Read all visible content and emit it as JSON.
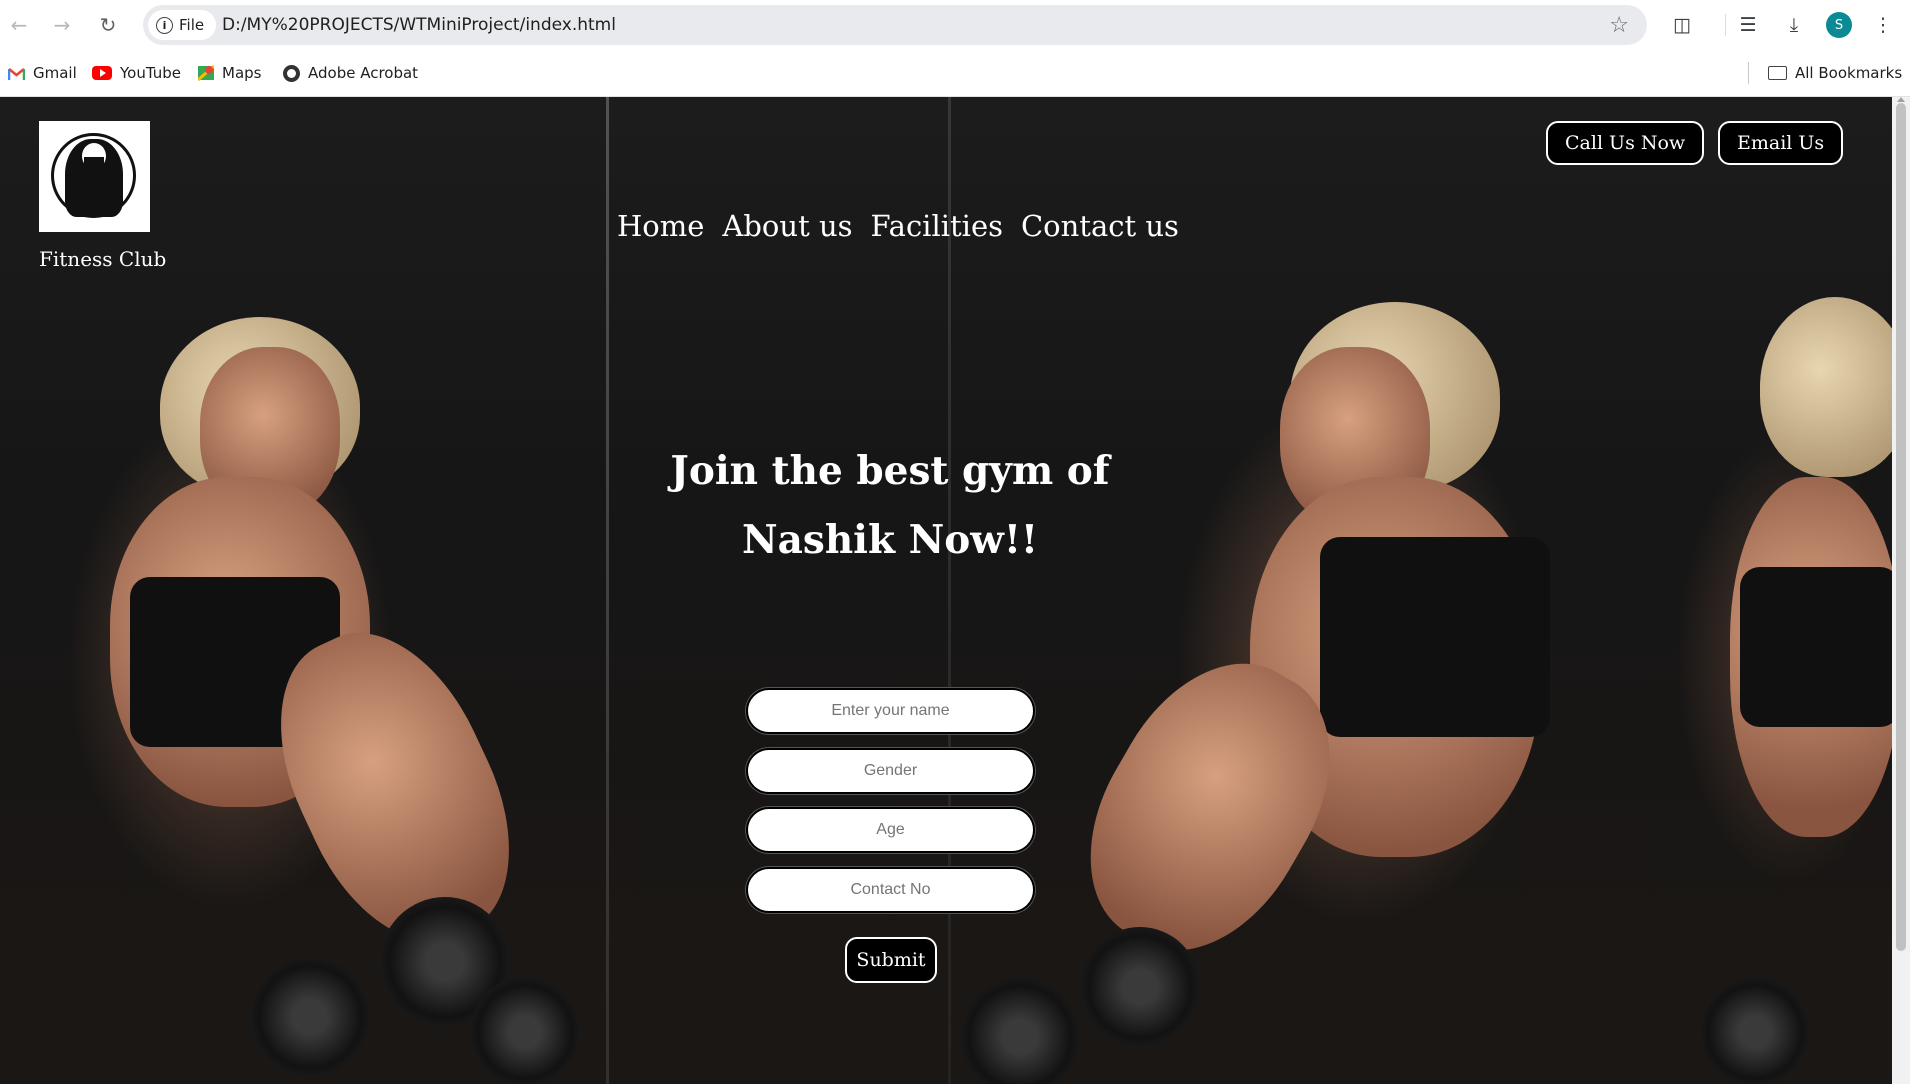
{
  "browser": {
    "back_icon": "arrow-left",
    "forward_icon": "arrow-right",
    "reload_icon": "reload",
    "site_chip": "File",
    "url": "D:/MY%20PROJECTS/WTMiniProject/index.html",
    "profile_initial": "S",
    "bookmarks": [
      {
        "label": "Gmail"
      },
      {
        "label": "YouTube"
      },
      {
        "label": "Maps"
      },
      {
        "label": "Adobe Acrobat"
      }
    ],
    "all_bookmarks": "All Bookmarks"
  },
  "page": {
    "brand": "Fitness Club",
    "nav": [
      "Home",
      "About us",
      "Facilities",
      "Contact us"
    ],
    "cta": {
      "call": "Call Us Now",
      "email": "Email Us"
    },
    "headline": "Join the best gym of Nashik Now!!",
    "form": {
      "name_placeholder": "Enter your name",
      "gender_placeholder": "Gender",
      "age_placeholder": "Age",
      "contact_placeholder": "Contact No",
      "submit": "Submit"
    }
  },
  "colors": {
    "avatar": "#0b8a96",
    "page_bg": "#141414"
  }
}
